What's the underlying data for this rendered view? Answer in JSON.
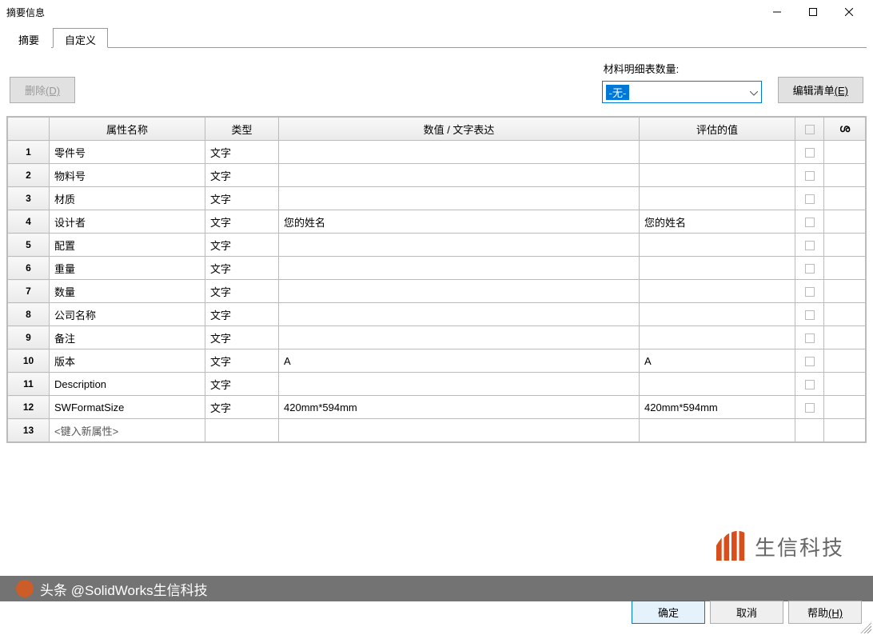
{
  "window": {
    "title": "摘要信息"
  },
  "tabs": {
    "summary": "摘要",
    "custom": "自定义"
  },
  "controls": {
    "delete": "删除",
    "delete_mnemonic": "(D)",
    "bom_label": "材料明细表数量:",
    "bom_selected": "-无-",
    "edit_list": "编辑清单",
    "edit_list_mnemonic": "(E)"
  },
  "table": {
    "headers": {
      "name": "属性名称",
      "type": "类型",
      "value": "数值 / 文字表达",
      "eval": "评估的值",
      "link": "ശ"
    },
    "rows": [
      {
        "n": 1,
        "name": "零件号",
        "type": "文字",
        "value": "",
        "eval": ""
      },
      {
        "n": 2,
        "name": "物料号",
        "type": "文字",
        "value": "",
        "eval": ""
      },
      {
        "n": 3,
        "name": "材质",
        "type": "文字",
        "value": "",
        "eval": ""
      },
      {
        "n": 4,
        "name": "设计者",
        "type": "文字",
        "value": "您的姓名",
        "eval": "您的姓名"
      },
      {
        "n": 5,
        "name": "配置",
        "type": "文字",
        "value": "",
        "eval": ""
      },
      {
        "n": 6,
        "name": "重量",
        "type": "文字",
        "value": "",
        "eval": ""
      },
      {
        "n": 7,
        "name": "数量",
        "type": "文字",
        "value": "",
        "eval": ""
      },
      {
        "n": 8,
        "name": "公司名称",
        "type": "文字",
        "value": "",
        "eval": ""
      },
      {
        "n": 9,
        "name": "备注",
        "type": "文字",
        "value": "",
        "eval": ""
      },
      {
        "n": 10,
        "name": "版本",
        "type": "文字",
        "value": "A",
        "eval": "A"
      },
      {
        "n": 11,
        "name": "Description",
        "type": "文字",
        "value": "",
        "eval": ""
      },
      {
        "n": 12,
        "name": "SWFormatSize",
        "type": "文字",
        "value": "420mm*594mm",
        "eval": "420mm*594mm"
      }
    ],
    "new_row_placeholder": "<键入新属性>",
    "new_row_num": 13
  },
  "watermark": {
    "logo_text": "生信科技",
    "bar_text": "头条 @SolidWorks生信科技"
  },
  "buttons": {
    "ok": "确定",
    "cancel": "取消",
    "help": "帮助",
    "help_mnemonic": "(H)"
  }
}
